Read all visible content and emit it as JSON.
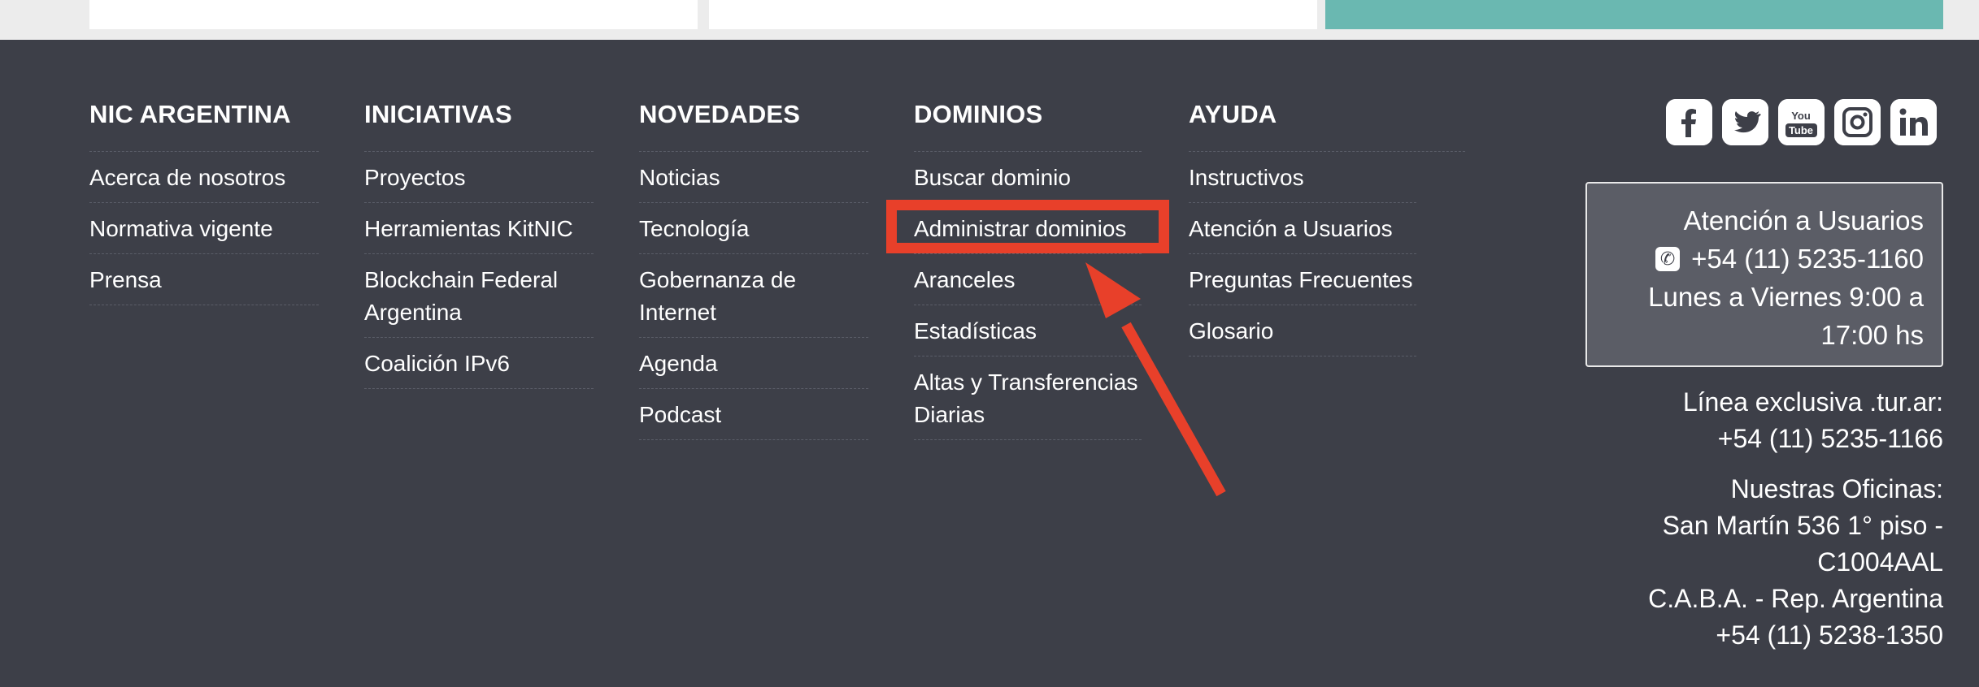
{
  "columns": [
    {
      "id": "nic",
      "title": "NIC ARGENTINA",
      "items": [
        "Acerca de nosotros",
        "Normativa vigente",
        "Prensa"
      ]
    },
    {
      "id": "ini",
      "title": "INICIATIVAS",
      "items": [
        "Proyectos",
        "Herramientas KitNIC",
        "Blockchain Federal Argentina",
        "Coalición IPv6"
      ]
    },
    {
      "id": "nov",
      "title": "NOVEDADES",
      "items": [
        "Noticias",
        "Tecnología",
        "Gobernanza de Internet",
        "Agenda",
        "Podcast"
      ]
    },
    {
      "id": "dom",
      "title": "DOMINIOS",
      "items": [
        "Buscar dominio",
        "Administrar dominios",
        "Aranceles",
        "Estadísticas",
        "Altas y Transferencias Diarias"
      ]
    },
    {
      "id": "ayu",
      "title": "AYUDA",
      "items": [
        "Instructivos",
        "Atención a Usuarios",
        "Preguntas Frecuentes",
        "Glosario"
      ]
    }
  ],
  "social": [
    {
      "icon": "facebook-icon",
      "glyph": "f"
    },
    {
      "icon": "twitter-icon",
      "glyph": "t"
    },
    {
      "icon": "youtube-icon",
      "glyph": "You Tube"
    },
    {
      "icon": "instagram-icon",
      "glyph": "◎"
    },
    {
      "icon": "linkedin-icon",
      "glyph": "in"
    }
  ],
  "contact": {
    "title": "Atención a Usuarios",
    "phone": "+54 (11) 5235-1160",
    "hours_line1": "Lunes a Viernes 9:00 a",
    "hours_line2": "17:00 hs"
  },
  "tur": {
    "line1": "Línea exclusiva .tur.ar:",
    "line2": "+54 (11) 5235-1166"
  },
  "offices": {
    "line1": "Nuestras Oficinas:",
    "line2": "San Martín 536 1° piso -",
    "line3": "C1004AAL",
    "line4": "C.A.B.A. - Rep. Argentina",
    "line5": "+54 (11) 5238-1350"
  },
  "annotation": {
    "highlighted_item": "Administrar dominios",
    "color": "#e8402a"
  }
}
